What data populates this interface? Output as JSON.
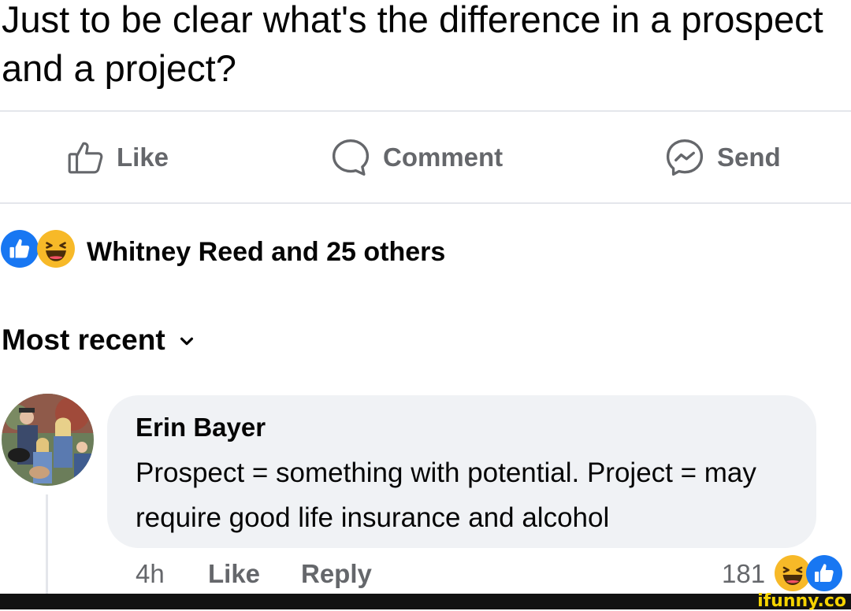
{
  "post": {
    "text": "Just to be clear what's the difference in a prospect and a project?"
  },
  "actions": {
    "like_label": "Like",
    "like_icon": "thumbs-up-outline-icon",
    "comment_label": "Comment",
    "comment_icon": "speech-bubble-icon",
    "send_label": "Send",
    "send_icon": "messenger-icon"
  },
  "reactions": {
    "summary": "Whitney Reed and 25 others",
    "icons": [
      "like-reaction-icon",
      "haha-reaction-icon"
    ]
  },
  "sort": {
    "label": "Most recent",
    "icon": "chevron-down-icon"
  },
  "comment": {
    "author": "Erin Bayer",
    "text": "Prospect = something with potential. Project = may require good life insurance and alcohol",
    "time": "4h",
    "like_label": "Like",
    "reply_label": "Reply",
    "reaction_count": "181",
    "reaction_icons": [
      "haha-reaction-icon",
      "like-reaction-icon"
    ]
  },
  "watermark": {
    "text": "ifunny.co"
  },
  "colors": {
    "like_blue": "#1877f2",
    "haha_yellow": "#f7b928",
    "muted_text": "#65676b",
    "bubble_bg": "#f0f2f5"
  }
}
